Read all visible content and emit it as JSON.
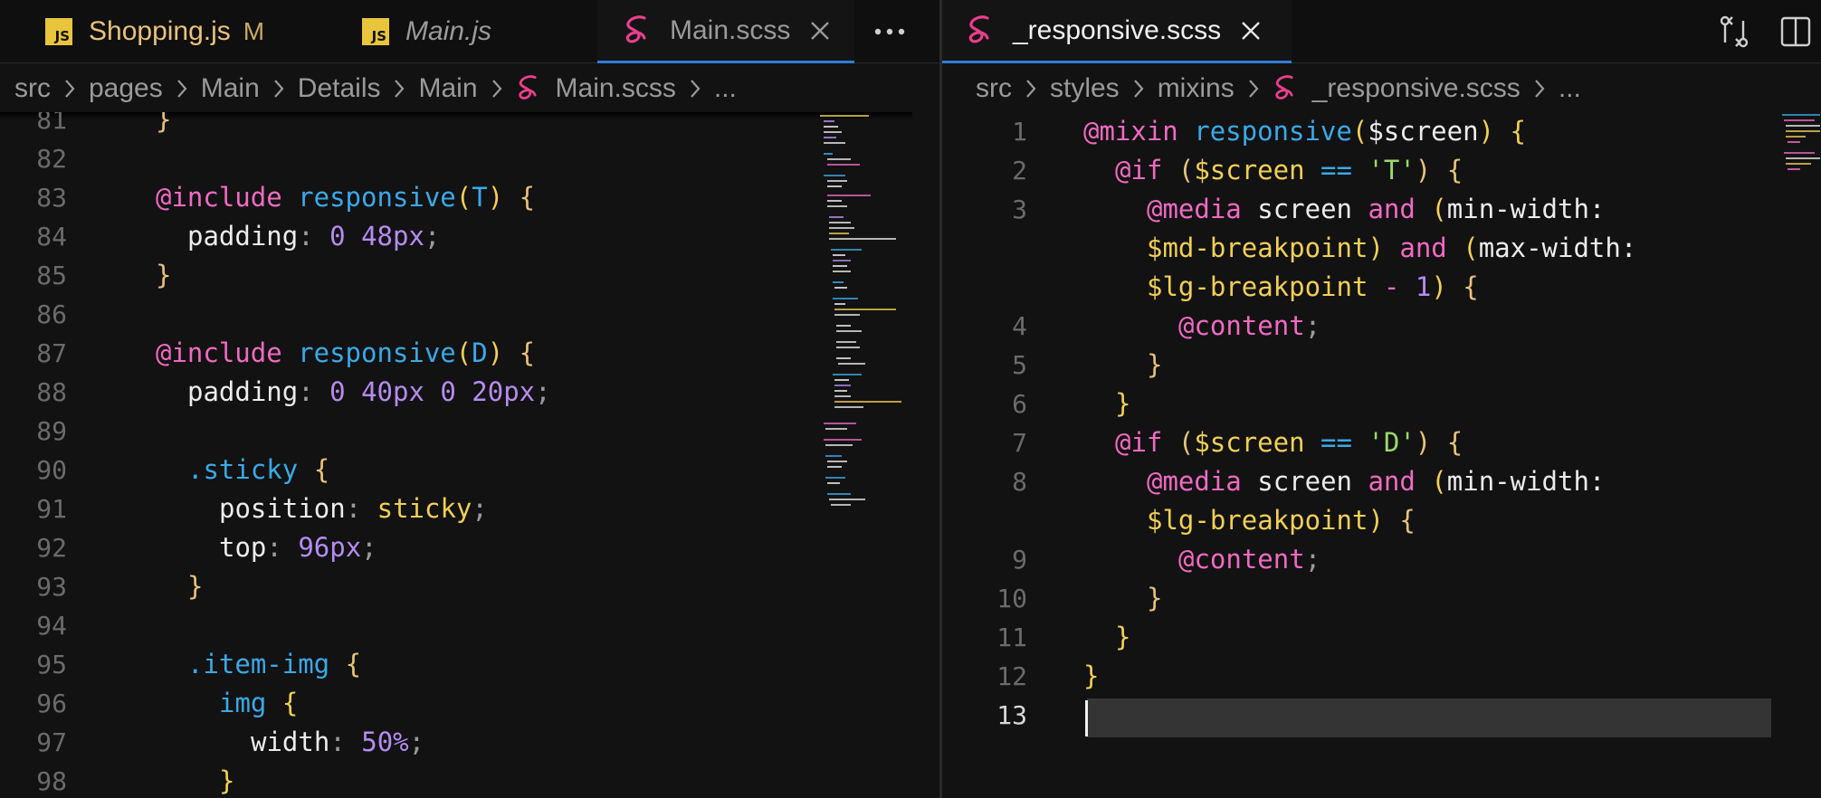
{
  "left_tabs": [
    {
      "label": "Shopping.js",
      "badge": "M",
      "icon": "js-icon"
    },
    {
      "label": "Main.js",
      "icon": "js-icon"
    },
    {
      "label": "Main.scss",
      "icon": "sass-icon",
      "active": true
    }
  ],
  "left_breadcrumb": [
    "src",
    "pages",
    "Main",
    "Details",
    "Main",
    "Main.scss",
    "..."
  ],
  "right_tab": {
    "label": "_responsive.scss",
    "icon": "sass-icon"
  },
  "right_breadcrumb": [
    "src",
    "styles",
    "mixins",
    "_responsive.scss",
    "..."
  ],
  "left_line_numbers": [
    "81",
    "82",
    "83",
    "84",
    "85",
    "86",
    "87",
    "88",
    "89",
    "90",
    "91",
    "92",
    "93",
    "94",
    "95",
    "96",
    "97",
    "98"
  ],
  "right_line_numbers": [
    "1",
    "2",
    "3",
    "",
    "",
    "4",
    "5",
    "6",
    "7",
    "8",
    "",
    "9",
    "10",
    "11",
    "12",
    "13"
  ],
  "colors": {
    "keyword": "#f06ac2",
    "function": "#3aa9e8",
    "number": "#b58cf0",
    "variable": "#f2cf55",
    "string": "#9bd86a",
    "bracket": "#e8c27a"
  },
  "left_code": {
    "l81": "}",
    "l83a": "@include",
    "l83b": "responsive",
    "l83c": "(",
    "l83d": "T",
    "l83e": ")",
    "l83f": "{",
    "l84a": "padding",
    "l84b": ":",
    "l84c": "0 48px",
    "l84d": ";",
    "l85": "}",
    "l87a": "@include",
    "l87b": "responsive",
    "l87c": "(",
    "l87d": "D",
    "l87e": ")",
    "l87f": "{",
    "l88a": "padding",
    "l88b": ":",
    "l88c": "0 40px 0 20px",
    "l88d": ";",
    "l90a": ".sticky",
    "l90b": "{",
    "l91a": "position",
    "l91b": ":",
    "l91c": "sticky",
    "l91d": ";",
    "l92a": "top",
    "l92b": ":",
    "l92c": "96px",
    "l92d": ";",
    "l93": "}",
    "l95a": ".item-img",
    "l95b": "{",
    "l96a": "img",
    "l96b": "{",
    "l97a": "width",
    "l97b": ":",
    "l97c": "50%",
    "l97d": ";",
    "l98": "}"
  },
  "right_code": {
    "r1a": "@mixin",
    "r1b": "responsive",
    "r1c": "(",
    "r1d": "$screen",
    "r1e": ")",
    "r1f": "{",
    "r2a": "@if",
    "r2b": "(",
    "r2c": "$screen",
    "r2d": "==",
    "r2e": "'T'",
    "r2f": ")",
    "r2g": "{",
    "r3a": "@media",
    "r3b": "screen",
    "r3c": "and",
    "r3d": "(",
    "r3e": "min-width:",
    "r3f": "$md-breakpoint",
    "r3g": ")",
    "r3h": "and",
    "r3i": "(",
    "r3j": "max-width:",
    "r3k": "$lg-breakpoint",
    "r3l": "-",
    "r3m": "1",
    "r3n": ")",
    "r3o": "{",
    "r4": "@content",
    "r4b": ";",
    "r5": "}",
    "r6": "}",
    "r7a": "@if",
    "r7b": "(",
    "r7c": "$screen",
    "r7d": "==",
    "r7e": "'D'",
    "r7f": ")",
    "r7g": "{",
    "r8a": "@media",
    "r8b": "screen",
    "r8c": "and",
    "r8d": "(",
    "r8e": "min-width:",
    "r8f": "$lg-breakpoint",
    "r8g": ")",
    "r8h": "{",
    "r9": "@content",
    "r9b": ";",
    "r10": "}",
    "r11": "}",
    "r12": "}"
  }
}
